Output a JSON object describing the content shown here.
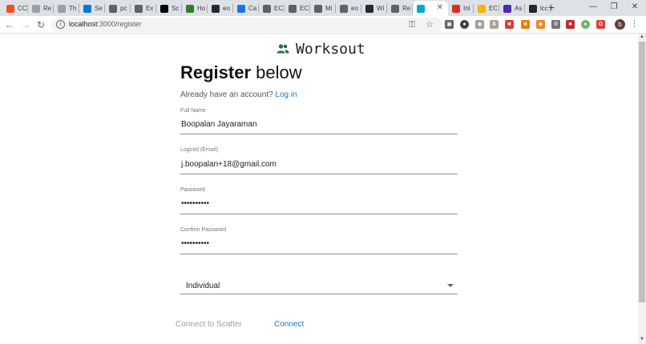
{
  "browser": {
    "tabs": [
      {
        "label": "CC",
        "icon": "microsoft-icon",
        "color": "#f25022"
      },
      {
        "label": "Re",
        "icon": "page-icon",
        "color": "#9aa0a6"
      },
      {
        "label": "Th",
        "icon": "page-icon",
        "color": "#9aa0a6"
      },
      {
        "label": "Se",
        "icon": "azure-icon",
        "color": "#0078d4"
      },
      {
        "label": "pc",
        "icon": "disabled-icon",
        "color": "#5f6368"
      },
      {
        "label": "Ex",
        "icon": "flask-icon",
        "color": "#5f6368"
      },
      {
        "label": "Sc",
        "icon": "notion-icon",
        "color": "#000000"
      },
      {
        "label": "Ho",
        "icon": "hubspot-icon",
        "color": "#2e7d32"
      },
      {
        "label": "eo",
        "icon": "github-icon",
        "color": "#24292e"
      },
      {
        "label": "Ca",
        "icon": "calendar-icon",
        "color": "#1a73e8"
      },
      {
        "label": "EC",
        "icon": "flask-icon",
        "color": "#5f6368"
      },
      {
        "label": "EC",
        "icon": "flask-icon",
        "color": "#5f6368"
      },
      {
        "label": "Mi",
        "icon": "diamond-icon",
        "color": "#5f6368"
      },
      {
        "label": "eo",
        "icon": "disabled-icon",
        "color": "#5f6368"
      },
      {
        "label": "Wi",
        "icon": "github-icon",
        "color": "#24292e"
      },
      {
        "label": "Re",
        "icon": "flask-icon",
        "color": "#5f6368"
      },
      {
        "label": "",
        "icon": "react-icon",
        "color": "#00acc1",
        "active": true
      },
      {
        "label": "Inl",
        "icon": "gmail-icon",
        "color": "#d93025"
      },
      {
        "label": "EC",
        "icon": "slides-icon",
        "color": "#f4b400"
      },
      {
        "label": "As",
        "icon": "asana-icon",
        "color": "#4c2ab5"
      },
      {
        "label": "lcc",
        "icon": "github-icon",
        "color": "#24292e"
      }
    ],
    "new_tab_label": "+",
    "url_host": "localhost",
    "url_path": ":3000/register",
    "profile_initial": "b"
  },
  "page": {
    "brand": "Worksout",
    "title_bold": "Register",
    "title_rest": " below",
    "login_prompt": "Already have an account? ",
    "login_link": "Log in",
    "fields": {
      "full_name": {
        "label": "Full Name",
        "value": "Boopalan Jayaraman"
      },
      "login_id": {
        "label": "LoginId (Email)",
        "value": "j.boopalan+18@gmail.com"
      },
      "password": {
        "label": "Password",
        "value": "••••••••••"
      },
      "confirm_password": {
        "label": "Confirm Password",
        "value": "••••••••••"
      }
    },
    "account_type": {
      "selected": "Individual"
    },
    "buttons": {
      "scatter": "Connect to Scatter",
      "connect": "Connect"
    }
  },
  "colors": {
    "accent": "#1976d2",
    "brand_icon": "#1e6f3a"
  }
}
